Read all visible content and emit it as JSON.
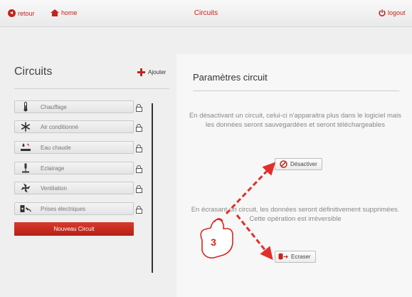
{
  "topbar": {
    "back_label": "retour",
    "home_label": "home",
    "title": "Circuits",
    "logout_label": "logout"
  },
  "sidebar": {
    "title": "Circuits",
    "add_label": "Ajouter",
    "items": [
      {
        "label": "Chauffage",
        "icon": "thermometer-icon"
      },
      {
        "label": "Air conditionné",
        "icon": "snowflake-icon"
      },
      {
        "label": "Eau chaude",
        "icon": "hot-water-icon"
      },
      {
        "label": "Eclairage",
        "icon": "lamp-icon"
      },
      {
        "label": "Ventilation",
        "icon": "fan-icon"
      },
      {
        "label": "Prises électriques",
        "icon": "plug-icon"
      }
    ],
    "new_circuit_label": "Nouveau Circuit"
  },
  "main": {
    "title": "Paramètres circuit",
    "deactivate_text": "En désactivant un circuit, celui-ci n'apparaitra plus dans le logiciel mais les données seront sauvegardées et seront téléchargeables",
    "deactivate_label": "Désactiver",
    "overwrite_text": "En écrasant un circuit, les données seront définitivement supprimées. Cette opération est irréversible",
    "overwrite_label": "Ecraser"
  },
  "annotation": {
    "step_number": "3"
  },
  "colors": {
    "accent": "#c0261d",
    "arrow": "#e0302a"
  }
}
